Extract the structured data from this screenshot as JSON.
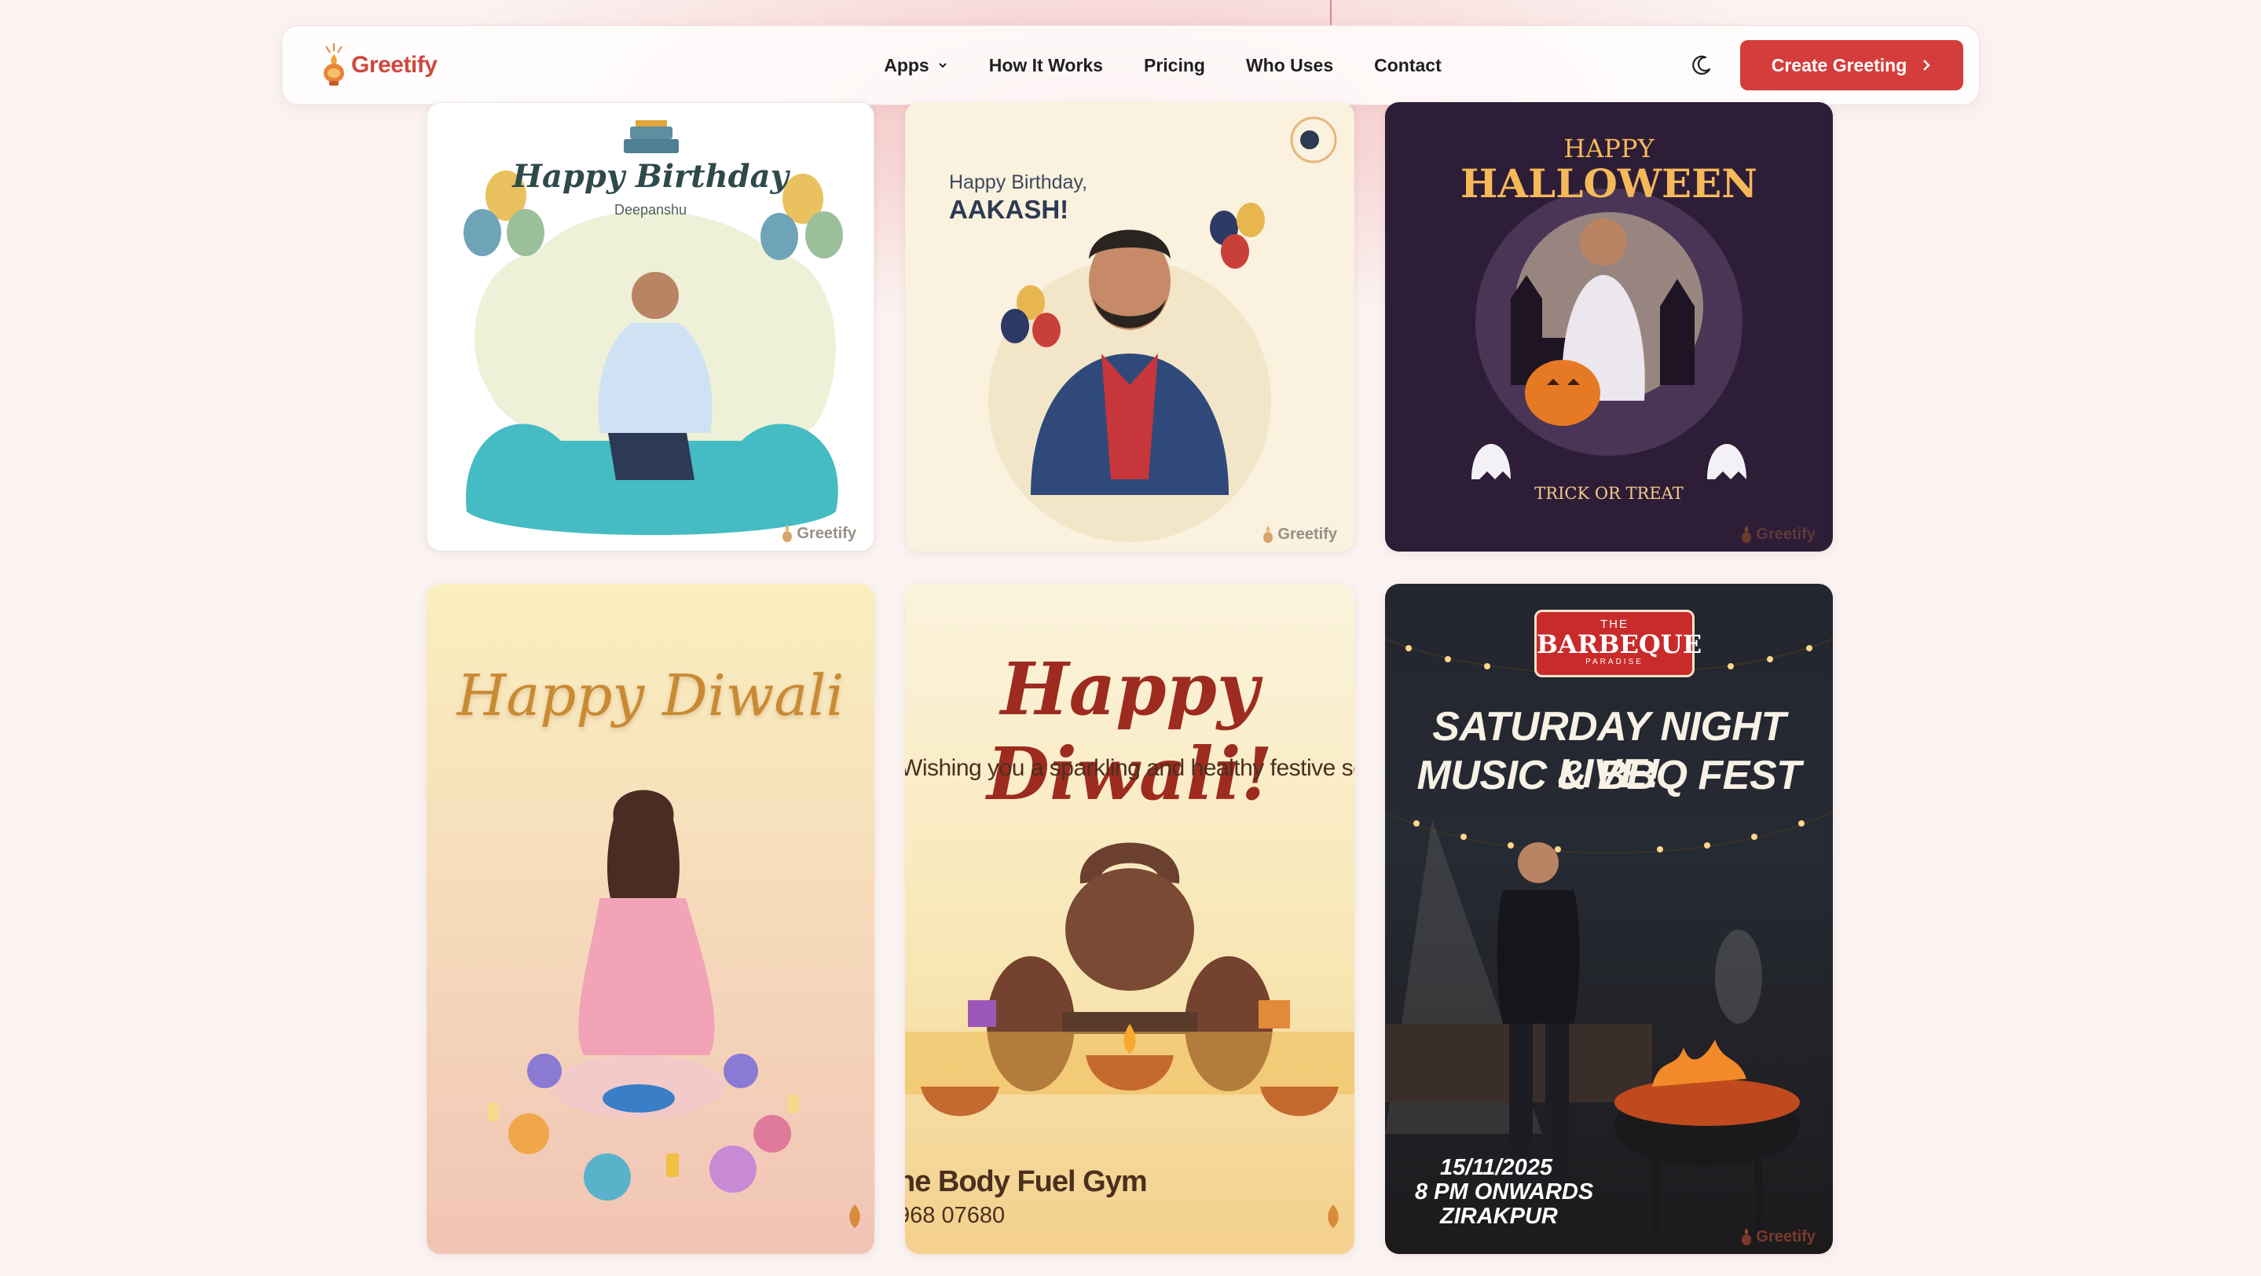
{
  "brand": {
    "name": "Greetify",
    "icon": "diya-lamp-icon",
    "color": "#d0483d"
  },
  "nav": {
    "items": [
      {
        "label": "Apps",
        "has_dropdown": true
      },
      {
        "label": "How It Works"
      },
      {
        "label": "Pricing"
      },
      {
        "label": "Who Uses"
      },
      {
        "label": "Contact"
      }
    ],
    "theme_toggle_icon": "moon-icon",
    "cta_label": "Create Greeting",
    "cta_color": "#d43d3b"
  },
  "cards": {
    "birthday_deepanshu": {
      "title": "Happy Birthday",
      "name": "Deepanshu",
      "watermark": "Greetify"
    },
    "birthday_aakash": {
      "line1": "Happy Birthday,",
      "line2": "AAKASH!",
      "watermark": "Greetify"
    },
    "halloween": {
      "line1": "HAPPY",
      "line2": "HALLOWEEN",
      "line3": "TRICK OR TREAT",
      "watermark": "Greetify"
    },
    "diwali_rangoli": {
      "title": "Happy Diwali"
    },
    "diwali_gym": {
      "title": "Happy Diwali!",
      "subtitle": "Wishing you a sparkling and healthy festive seaso",
      "business": "he Body Fuel Gym",
      "phone": "968 07680"
    },
    "bbq_event": {
      "badge_top": "THE",
      "badge_main": "BARBEQUE",
      "badge_bottom": "PARADISE",
      "headline1": "SATURDAY NIGHT LIVE!",
      "headline2": "MUSIC & BBQ FEST",
      "date": "15/11/2025",
      "time": "8 PM ONWARDS",
      "place": "ZIRAKPUR",
      "watermark": "Greetify"
    }
  }
}
